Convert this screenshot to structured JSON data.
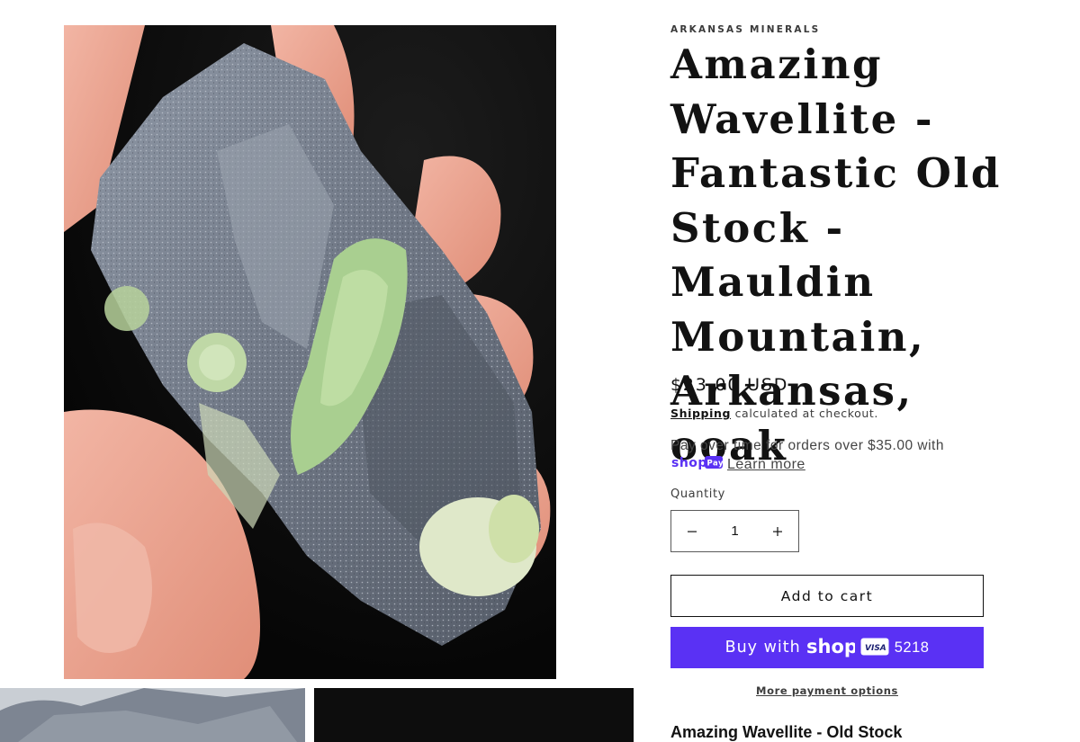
{
  "product": {
    "vendor": "ARKANSAS MINERALS",
    "title": "Amazing Wavellite - Fantastic Old Stock - Mauldin Mountain, Arkansas, ooak",
    "price": "$23.00 USD",
    "shipping_link": "Shipping",
    "shipping_text": " calculated at checkout.",
    "installments_text": "Pay over time for orders over $35.00 with",
    "learn_more": "Learn more",
    "shoppay_badge_text": "shop Pay",
    "quantity_label": "Quantity",
    "quantity_value": "1",
    "add_to_cart": "Add to cart",
    "buy_now_prefix": "Buy with",
    "buy_now_brand": "shop",
    "card_brand": "VISA",
    "card_last4": "5218",
    "more_payment_options": "More payment options",
    "description_peek": "Amazing Wavellite - Old Stock"
  },
  "gallery": {
    "main_image": "mineral-specimen-photo",
    "thumbnails": [
      "mineral-thumbnail-1",
      "mineral-thumbnail-2"
    ]
  },
  "colors": {
    "shoppay_purple": "#5a31f4",
    "text": "#121212",
    "background": "#ffffff"
  },
  "icons": [
    "minus-icon",
    "plus-icon",
    "shop-pay-icon",
    "visa-card-icon"
  ]
}
